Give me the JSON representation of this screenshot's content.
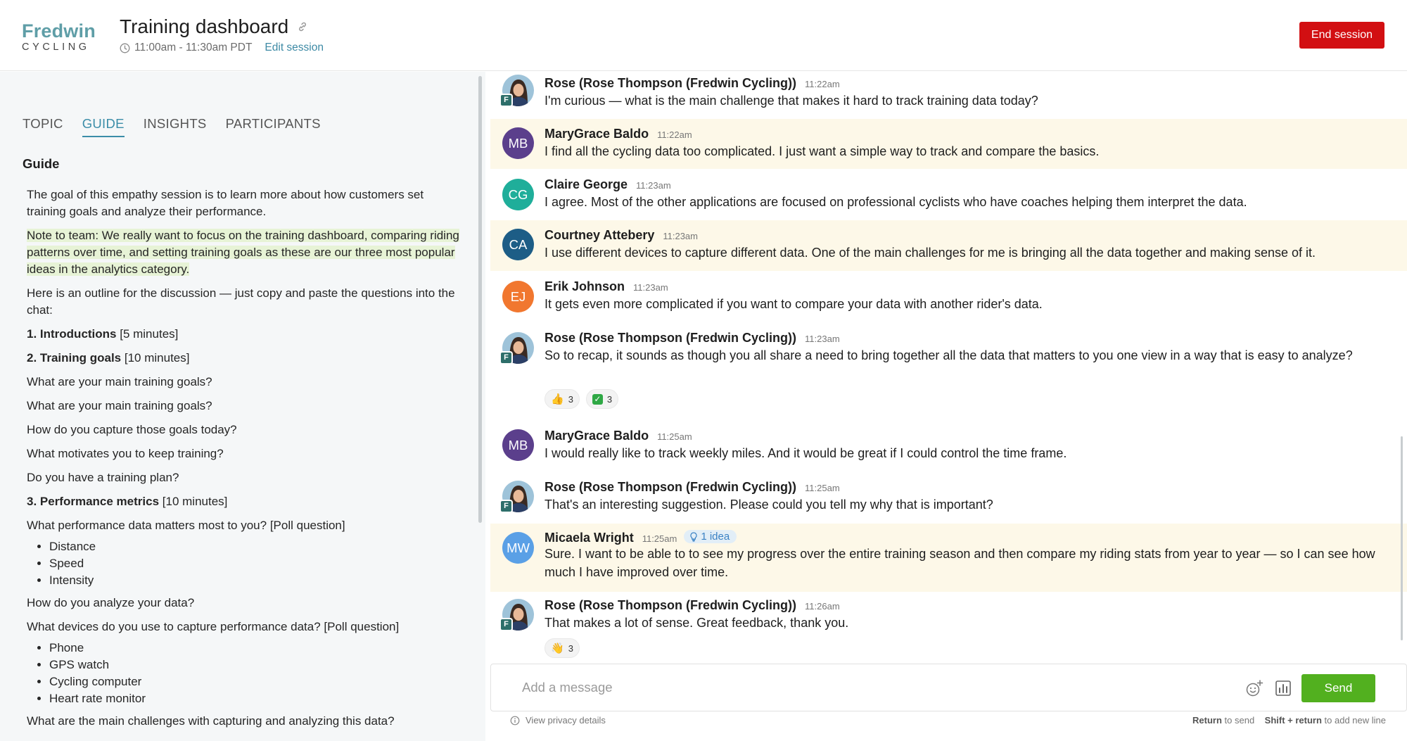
{
  "header": {
    "logo_main": "Fredwin",
    "logo_sub": "CYCLING",
    "title": "Training dashboard",
    "time": "11:00am - 11:30am PDT",
    "edit_label": "Edit session",
    "end_label": "End session"
  },
  "tabs": [
    {
      "label": "TOPIC"
    },
    {
      "label": "GUIDE"
    },
    {
      "label": "INSIGHTS"
    },
    {
      "label": "PARTICIPANTS"
    }
  ],
  "guide": {
    "heading": "Guide",
    "intro": "The goal of this empathy session is to learn more about how customers set training goals and analyze their performance.",
    "note": "Note to team: We really want to focus on the training dashboard, comparing riding patterns over time, and setting training goals as these are  our three most popular ideas in the analytics category.",
    "outline": "Here is an outline for the discussion — just copy and paste the questions into the chat:",
    "s1_title": "1. Introductions",
    "s1_time": " [5 minutes]",
    "s2_title": "2. Training goals",
    "s2_time": " [10 minutes]",
    "q1": "What are your main training goals?",
    "q2": "What are your main training goals?",
    "q3": "How do you capture those goals today?",
    "q4": "What motivates you to keep training?",
    "q5": "Do you have a training plan?",
    "s3_title": "3. Performance metrics",
    "s3_time": " [10 minutes]",
    "q6": "What performance data matters most to you? [Poll question]",
    "list1": [
      "Distance",
      "Speed",
      "Intensity"
    ],
    "q7": "How do you analyze your data?",
    "q8": "What devices do you use to capture performance data? [Poll question]",
    "list2": [
      "Phone",
      "GPS watch",
      "Cycling computer",
      "Heart rate monitor"
    ],
    "q9": "What are the main challenges with capturing and analyzing this data?"
  },
  "messages": [
    {
      "sender": "Rose (Rose Thompson (Fredwin Cycling))",
      "time": "11:22am",
      "text": "I'm curious — what is the main challenge that makes it hard to track training data today?"
    },
    {
      "sender": "MaryGrace Baldo",
      "initials": "MB",
      "time": "11:22am",
      "text": "I find all the cycling data too complicated. I just want a simple way to track and compare the basics."
    },
    {
      "sender": "Claire George",
      "initials": "CG",
      "time": "11:23am",
      "text": "I agree. Most of the other applications are focused on professional cyclists who have coaches helping them interpret the data."
    },
    {
      "sender": "Courtney Attebery",
      "initials": "CA",
      "time": "11:23am",
      "text": "I use different devices to capture different data. One of the main challenges for me is bringing all the data together and making sense of it."
    },
    {
      "sender": "Erik Johnson",
      "initials": "EJ",
      "time": "11:23am",
      "text": "It gets even more complicated if you want to compare your data with another rider's data."
    },
    {
      "sender": "Rose (Rose Thompson (Fredwin Cycling))",
      "time": "11:23am",
      "text": "So to recap, it sounds as though you all share a need to bring together all the data that matters to you one view in a way that is easy to analyze?",
      "reactions": [
        {
          "emoji": "👍",
          "count": "3"
        },
        {
          "emoji": "✓",
          "count": "3"
        }
      ]
    },
    {
      "sender": "MaryGrace Baldo",
      "initials": "MB",
      "time": "11:25am",
      "text": "I would really like to track weekly miles. And it would be great if I could control the time frame."
    },
    {
      "sender": "Rose (Rose Thompson (Fredwin Cycling))",
      "time": "11:25am",
      "text": "That's an interesting suggestion. Please could you tell my why that is important?"
    },
    {
      "sender": "Micaela Wright",
      "initials": "MW",
      "time": "11:25am",
      "idea": "1 idea",
      "text": "Sure. I want to be able to to see my progress over the entire training season and then compare my riding stats from year to year — so I can see how much I have improved over time."
    },
    {
      "sender": "Rose (Rose Thompson (Fredwin Cycling))",
      "time": "11:26am",
      "text": "That makes a lot of sense. Great feedback, thank you.",
      "reactions": [
        {
          "emoji": "👋",
          "count": "3"
        }
      ]
    }
  ],
  "avatar_badge": "F",
  "colors": {
    "MB": "#5b3f8c",
    "CG": "#1fae9a",
    "CA": "#1d5d86",
    "EJ": "#f1772f",
    "MW": "#5aa0e6",
    "accent": "#3b8da8",
    "end": "#d20f12",
    "send": "#52b01f"
  },
  "composer": {
    "placeholder": "Add a message",
    "send_label": "Send"
  },
  "footer": {
    "privacy": "View privacy details",
    "return_key": "Return",
    "return_desc": " to send",
    "shift_key": "Shift + return",
    "shift_desc": " to add new line"
  }
}
